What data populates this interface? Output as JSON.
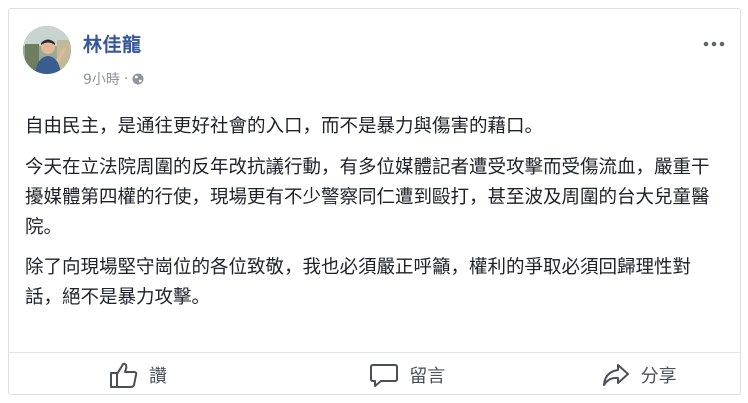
{
  "post": {
    "author": "林佳龍",
    "time": "9小時",
    "separator": "·",
    "paragraphs": [
      "自由民主，是通往更好社會的入口，而不是暴力與傷害的藉口。",
      "今天在立法院周圍的反年改抗議行動，有多位媒體記者遭受攻擊而受傷流血，嚴重干擾媒體第四權的行使，現場更有不少警察同仁遭到毆打，甚至波及周圍的台大兒童醫院。",
      "除了向現場堅守崗位的各位致敬，我也必須嚴正呼籲，權利的爭取必須回歸理性對話，絕不是暴力攻擊。"
    ]
  },
  "actions": {
    "like": "讚",
    "comment": "留言",
    "share": "分享"
  },
  "icons": {
    "avatar": "profile-photo",
    "privacy": "globe-icon",
    "more": "more-dots-icon",
    "like": "thumbs-up-icon",
    "comment": "comment-bubble-icon",
    "share": "share-arrow-icon"
  },
  "colors": {
    "author": "#365899",
    "meta": "#90949c",
    "text": "#1d2129",
    "action": "#4b4f56",
    "border": "#dddfe2"
  }
}
